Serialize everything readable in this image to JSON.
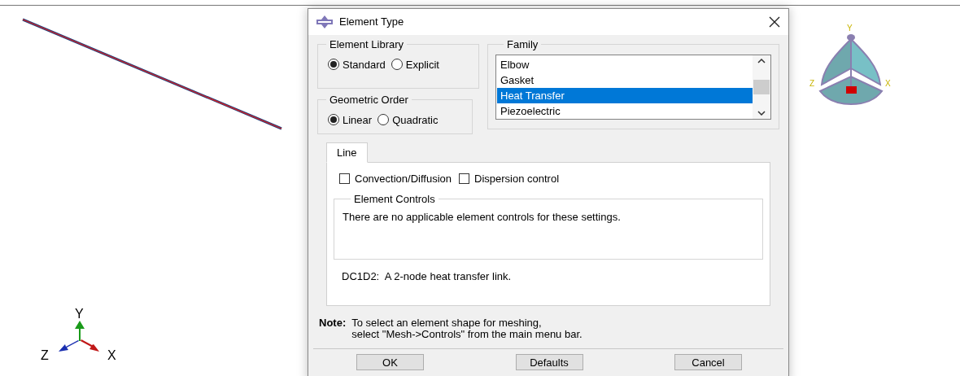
{
  "viewport": {
    "axis_triad": {
      "labels": [
        "Y",
        "Z",
        "X"
      ]
    },
    "view_cube": {
      "labels": [
        "Y",
        "Z",
        "X"
      ]
    }
  },
  "dialog": {
    "title": "Element Type",
    "element_library": {
      "title": "Element Library",
      "options": [
        {
          "label": "Standard",
          "selected": true
        },
        {
          "label": "Explicit",
          "selected": false
        }
      ]
    },
    "geometric_order": {
      "title": "Geometric Order",
      "options": [
        {
          "label": "Linear",
          "selected": true
        },
        {
          "label": "Quadratic",
          "selected": false
        }
      ]
    },
    "family": {
      "title": "Family",
      "items": [
        {
          "label": "Elbow",
          "selected": false
        },
        {
          "label": "Gasket",
          "selected": false
        },
        {
          "label": "Heat Transfer",
          "selected": true
        },
        {
          "label": "Piezoelectric",
          "selected": false
        }
      ]
    },
    "tabs": [
      {
        "label": "Line",
        "selected": true
      }
    ],
    "options": [
      {
        "label": "Convection/Diffusion",
        "checked": false
      },
      {
        "label": "Dispersion control",
        "checked": false
      }
    ],
    "element_controls": {
      "title": "Element Controls",
      "message": "There are no applicable element controls for these settings."
    },
    "description": "DC1D2:  A 2-node heat transfer link.",
    "note": {
      "label": "Note:",
      "lines": [
        "To select an element shape for meshing,",
        "select \"Mesh->Controls\" from the main menu bar."
      ]
    },
    "buttons": [
      "OK",
      "Defaults",
      "Cancel"
    ]
  }
}
